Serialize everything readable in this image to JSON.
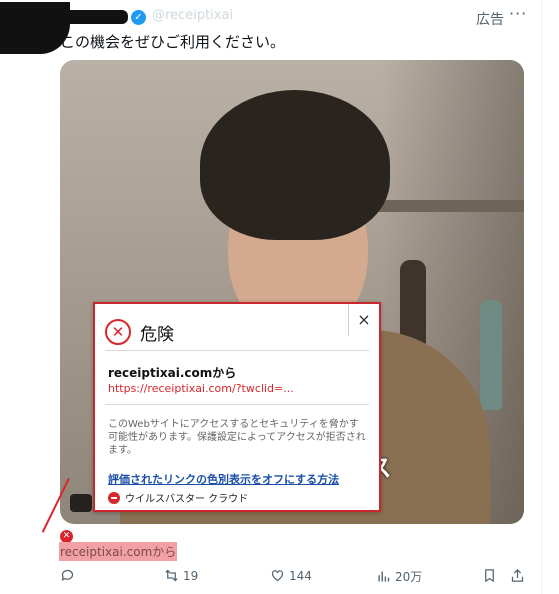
{
  "header": {
    "handle": "@receiptixai",
    "ad_label": "広告",
    "more_label": "···"
  },
  "tweet": {
    "text": "この機会をぜひご利用ください。",
    "video_caption": "ンス"
  },
  "warning_popup": {
    "title": "危険",
    "close_label": "×",
    "site_label": "receiptixai.comから",
    "url": "https://receiptixai.com/?twclid=...",
    "description": "このWebサイトにアクセスするとセキュリティを脅かす可能性があります。保護設定によってアクセスが拒否されます。",
    "help_link": "評価されたリンクの色別表示をオフにする方法",
    "brand": "ウイルスバスター クラウド"
  },
  "link_card": {
    "badge": "✕",
    "text": "receiptixai.comから"
  },
  "actions": {
    "reply_count": "",
    "retweet_count": "19",
    "like_count": "144",
    "views_count": "20万"
  },
  "colors": {
    "danger": "#d9262c",
    "link": "#1a4fa8",
    "muted": "#536471"
  }
}
